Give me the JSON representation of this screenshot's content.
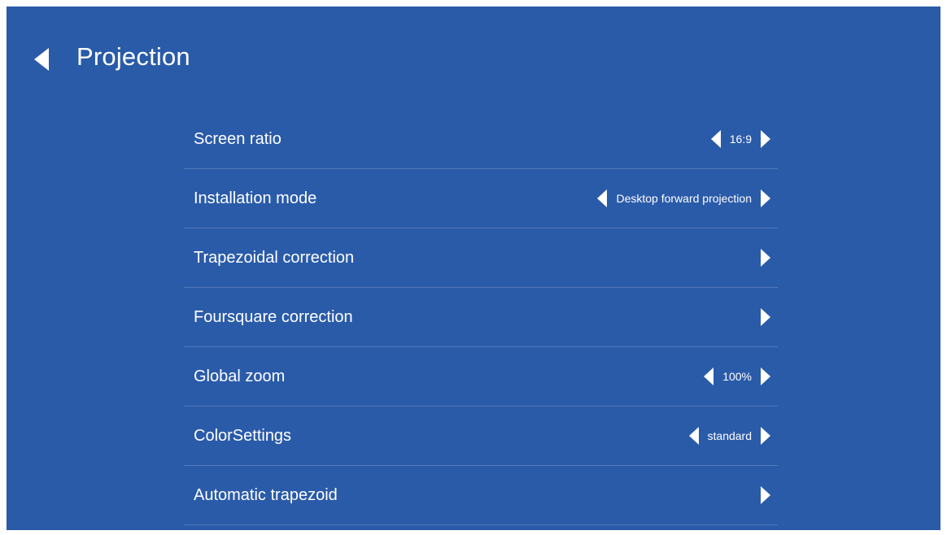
{
  "header": {
    "back_icon": "chevron-left-icon",
    "title": "Projection"
  },
  "colors": {
    "background": "#2a5ba9",
    "text": "#ffffff",
    "divider": "rgba(255,255,255,0.18)"
  },
  "settings": [
    {
      "label": "Screen ratio",
      "value": "16:9",
      "has_left": true,
      "has_right": true
    },
    {
      "label": "Installation mode",
      "value": "Desktop forward projection",
      "has_left": true,
      "has_right": true
    },
    {
      "label": "Trapezoidal correction",
      "value": "",
      "has_left": false,
      "has_right": true
    },
    {
      "label": "Foursquare correction",
      "value": "",
      "has_left": false,
      "has_right": true
    },
    {
      "label": "Global zoom",
      "value": "100%",
      "has_left": true,
      "has_right": true
    },
    {
      "label": "ColorSettings",
      "value": "standard",
      "has_left": true,
      "has_right": true
    },
    {
      "label": "Automatic trapezoid",
      "value": "",
      "has_left": false,
      "has_right": true
    }
  ]
}
